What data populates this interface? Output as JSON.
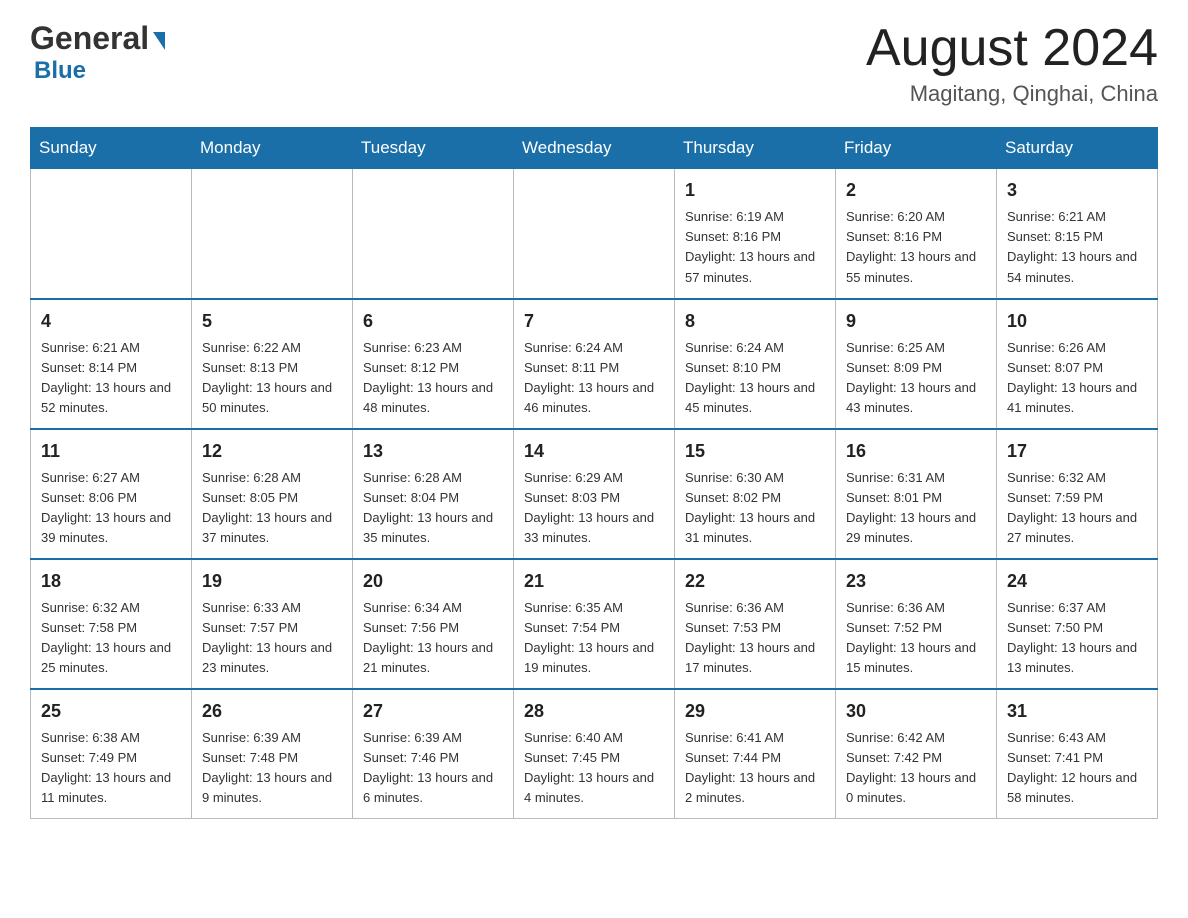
{
  "header": {
    "logo_general": "General",
    "logo_blue": "Blue",
    "month_title": "August 2024",
    "location": "Magitang, Qinghai, China"
  },
  "days_of_week": [
    "Sunday",
    "Monday",
    "Tuesday",
    "Wednesday",
    "Thursday",
    "Friday",
    "Saturday"
  ],
  "weeks": [
    [
      {
        "day": "",
        "sunrise": "",
        "sunset": "",
        "daylight": ""
      },
      {
        "day": "",
        "sunrise": "",
        "sunset": "",
        "daylight": ""
      },
      {
        "day": "",
        "sunrise": "",
        "sunset": "",
        "daylight": ""
      },
      {
        "day": "",
        "sunrise": "",
        "sunset": "",
        "daylight": ""
      },
      {
        "day": "1",
        "sunrise": "Sunrise: 6:19 AM",
        "sunset": "Sunset: 8:16 PM",
        "daylight": "Daylight: 13 hours and 57 minutes."
      },
      {
        "day": "2",
        "sunrise": "Sunrise: 6:20 AM",
        "sunset": "Sunset: 8:16 PM",
        "daylight": "Daylight: 13 hours and 55 minutes."
      },
      {
        "day": "3",
        "sunrise": "Sunrise: 6:21 AM",
        "sunset": "Sunset: 8:15 PM",
        "daylight": "Daylight: 13 hours and 54 minutes."
      }
    ],
    [
      {
        "day": "4",
        "sunrise": "Sunrise: 6:21 AM",
        "sunset": "Sunset: 8:14 PM",
        "daylight": "Daylight: 13 hours and 52 minutes."
      },
      {
        "day": "5",
        "sunrise": "Sunrise: 6:22 AM",
        "sunset": "Sunset: 8:13 PM",
        "daylight": "Daylight: 13 hours and 50 minutes."
      },
      {
        "day": "6",
        "sunrise": "Sunrise: 6:23 AM",
        "sunset": "Sunset: 8:12 PM",
        "daylight": "Daylight: 13 hours and 48 minutes."
      },
      {
        "day": "7",
        "sunrise": "Sunrise: 6:24 AM",
        "sunset": "Sunset: 8:11 PM",
        "daylight": "Daylight: 13 hours and 46 minutes."
      },
      {
        "day": "8",
        "sunrise": "Sunrise: 6:24 AM",
        "sunset": "Sunset: 8:10 PM",
        "daylight": "Daylight: 13 hours and 45 minutes."
      },
      {
        "day": "9",
        "sunrise": "Sunrise: 6:25 AM",
        "sunset": "Sunset: 8:09 PM",
        "daylight": "Daylight: 13 hours and 43 minutes."
      },
      {
        "day": "10",
        "sunrise": "Sunrise: 6:26 AM",
        "sunset": "Sunset: 8:07 PM",
        "daylight": "Daylight: 13 hours and 41 minutes."
      }
    ],
    [
      {
        "day": "11",
        "sunrise": "Sunrise: 6:27 AM",
        "sunset": "Sunset: 8:06 PM",
        "daylight": "Daylight: 13 hours and 39 minutes."
      },
      {
        "day": "12",
        "sunrise": "Sunrise: 6:28 AM",
        "sunset": "Sunset: 8:05 PM",
        "daylight": "Daylight: 13 hours and 37 minutes."
      },
      {
        "day": "13",
        "sunrise": "Sunrise: 6:28 AM",
        "sunset": "Sunset: 8:04 PM",
        "daylight": "Daylight: 13 hours and 35 minutes."
      },
      {
        "day": "14",
        "sunrise": "Sunrise: 6:29 AM",
        "sunset": "Sunset: 8:03 PM",
        "daylight": "Daylight: 13 hours and 33 minutes."
      },
      {
        "day": "15",
        "sunrise": "Sunrise: 6:30 AM",
        "sunset": "Sunset: 8:02 PM",
        "daylight": "Daylight: 13 hours and 31 minutes."
      },
      {
        "day": "16",
        "sunrise": "Sunrise: 6:31 AM",
        "sunset": "Sunset: 8:01 PM",
        "daylight": "Daylight: 13 hours and 29 minutes."
      },
      {
        "day": "17",
        "sunrise": "Sunrise: 6:32 AM",
        "sunset": "Sunset: 7:59 PM",
        "daylight": "Daylight: 13 hours and 27 minutes."
      }
    ],
    [
      {
        "day": "18",
        "sunrise": "Sunrise: 6:32 AM",
        "sunset": "Sunset: 7:58 PM",
        "daylight": "Daylight: 13 hours and 25 minutes."
      },
      {
        "day": "19",
        "sunrise": "Sunrise: 6:33 AM",
        "sunset": "Sunset: 7:57 PM",
        "daylight": "Daylight: 13 hours and 23 minutes."
      },
      {
        "day": "20",
        "sunrise": "Sunrise: 6:34 AM",
        "sunset": "Sunset: 7:56 PM",
        "daylight": "Daylight: 13 hours and 21 minutes."
      },
      {
        "day": "21",
        "sunrise": "Sunrise: 6:35 AM",
        "sunset": "Sunset: 7:54 PM",
        "daylight": "Daylight: 13 hours and 19 minutes."
      },
      {
        "day": "22",
        "sunrise": "Sunrise: 6:36 AM",
        "sunset": "Sunset: 7:53 PM",
        "daylight": "Daylight: 13 hours and 17 minutes."
      },
      {
        "day": "23",
        "sunrise": "Sunrise: 6:36 AM",
        "sunset": "Sunset: 7:52 PM",
        "daylight": "Daylight: 13 hours and 15 minutes."
      },
      {
        "day": "24",
        "sunrise": "Sunrise: 6:37 AM",
        "sunset": "Sunset: 7:50 PM",
        "daylight": "Daylight: 13 hours and 13 minutes."
      }
    ],
    [
      {
        "day": "25",
        "sunrise": "Sunrise: 6:38 AM",
        "sunset": "Sunset: 7:49 PM",
        "daylight": "Daylight: 13 hours and 11 minutes."
      },
      {
        "day": "26",
        "sunrise": "Sunrise: 6:39 AM",
        "sunset": "Sunset: 7:48 PM",
        "daylight": "Daylight: 13 hours and 9 minutes."
      },
      {
        "day": "27",
        "sunrise": "Sunrise: 6:39 AM",
        "sunset": "Sunset: 7:46 PM",
        "daylight": "Daylight: 13 hours and 6 minutes."
      },
      {
        "day": "28",
        "sunrise": "Sunrise: 6:40 AM",
        "sunset": "Sunset: 7:45 PM",
        "daylight": "Daylight: 13 hours and 4 minutes."
      },
      {
        "day": "29",
        "sunrise": "Sunrise: 6:41 AM",
        "sunset": "Sunset: 7:44 PM",
        "daylight": "Daylight: 13 hours and 2 minutes."
      },
      {
        "day": "30",
        "sunrise": "Sunrise: 6:42 AM",
        "sunset": "Sunset: 7:42 PM",
        "daylight": "Daylight: 13 hours and 0 minutes."
      },
      {
        "day": "31",
        "sunrise": "Sunrise: 6:43 AM",
        "sunset": "Sunset: 7:41 PM",
        "daylight": "Daylight: 12 hours and 58 minutes."
      }
    ]
  ]
}
